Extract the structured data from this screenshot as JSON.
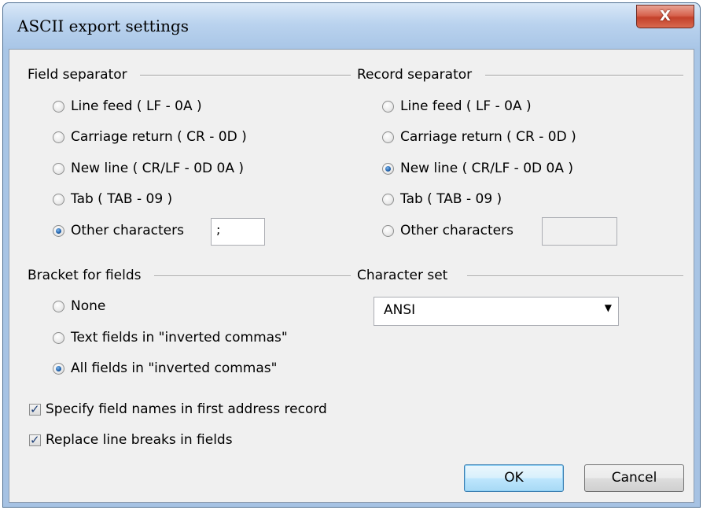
{
  "window": {
    "title": "ASCII export settings",
    "close_label": "X"
  },
  "field_separator": {
    "title": "Field separator",
    "options": [
      {
        "label": "Line feed ( LF - 0A )",
        "checked": false
      },
      {
        "label": "Carriage return ( CR - 0D )",
        "checked": false
      },
      {
        "label": "New line ( CR/LF - 0D 0A )",
        "checked": false
      },
      {
        "label": "Tab ( TAB - 09 )",
        "checked": false
      },
      {
        "label": "Other characters",
        "checked": true
      }
    ],
    "other_value": ";"
  },
  "record_separator": {
    "title": "Record separator",
    "options": [
      {
        "label": "Line feed ( LF - 0A )",
        "checked": false
      },
      {
        "label": "Carriage return ( CR - 0D )",
        "checked": false
      },
      {
        "label": "New line ( CR/LF - 0D 0A )",
        "checked": true
      },
      {
        "label": "Tab ( TAB - 09 )",
        "checked": false
      },
      {
        "label": "Other characters",
        "checked": false
      }
    ],
    "other_value": ""
  },
  "bracket": {
    "title": "Bracket for fields",
    "options": [
      {
        "label": "None",
        "checked": false
      },
      {
        "label": "Text fields in \"inverted commas\"",
        "checked": false
      },
      {
        "label": "All fields in \"inverted commas\"",
        "checked": true
      }
    ]
  },
  "charset": {
    "title": "Character set",
    "selected": "ANSI"
  },
  "checkboxes": [
    {
      "label": "Specify field names in first address record",
      "checked": true
    },
    {
      "label": "Replace line breaks in fields",
      "checked": true
    }
  ],
  "buttons": {
    "ok": "OK",
    "cancel": "Cancel"
  }
}
